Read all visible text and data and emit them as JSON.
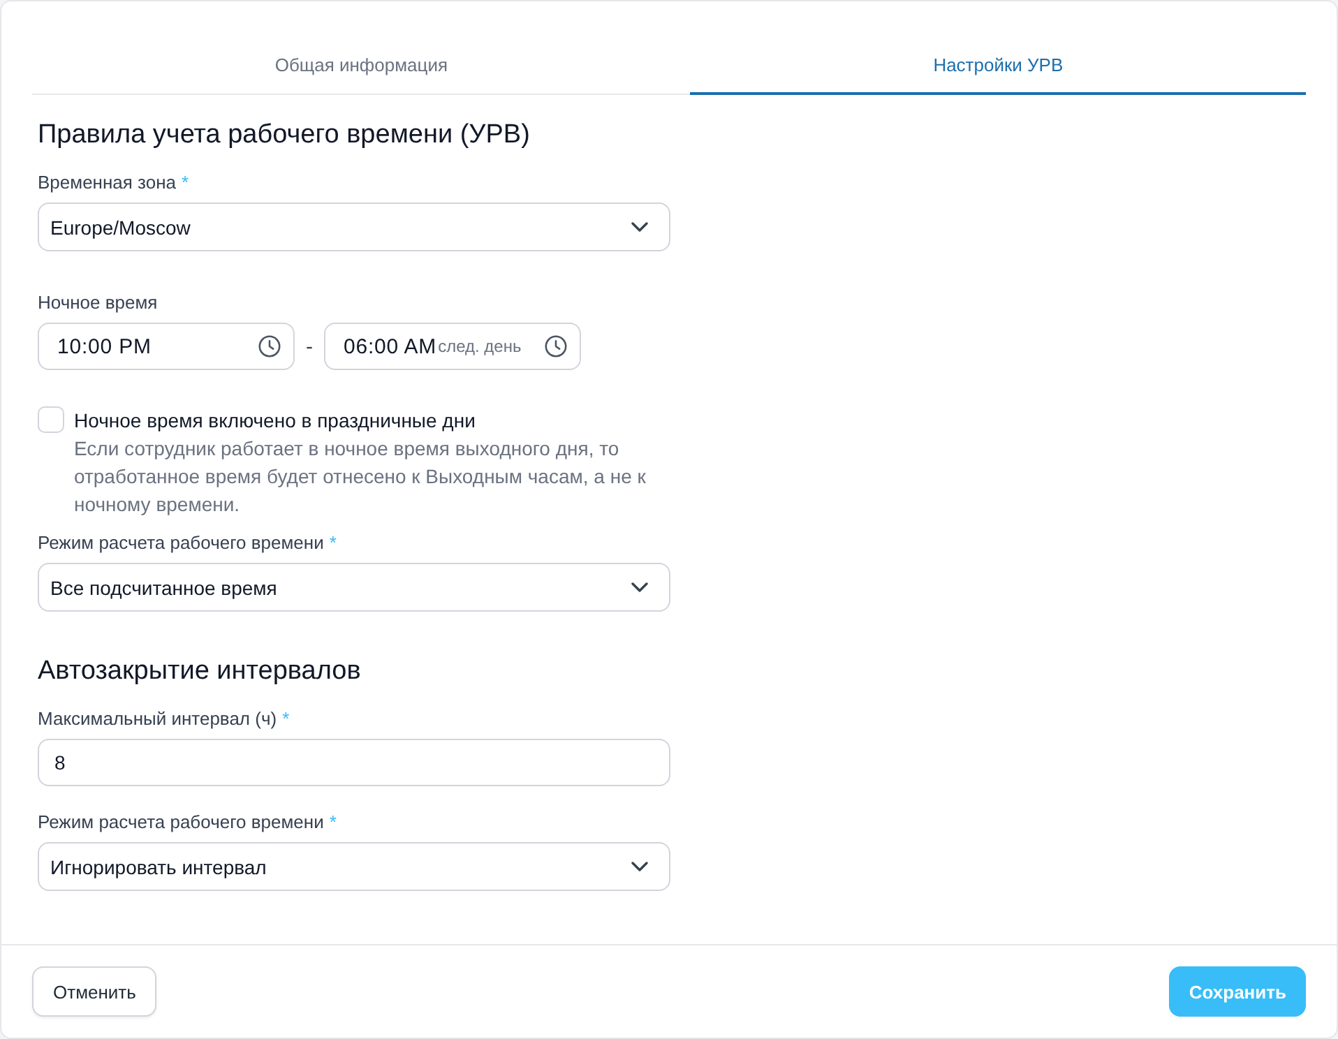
{
  "tabs": [
    {
      "label": "Общая информация",
      "selected": false
    },
    {
      "label": "Настройки УРВ",
      "selected": true
    }
  ],
  "sections": [
    {
      "title": "Правила учета рабочего времени (УРВ)",
      "fields": [
        {
          "kind": "select",
          "label": "Временная зона",
          "required_mark": "*",
          "value": "Europe/Moscow"
        },
        {
          "kind": "time_range",
          "label": "Ночное время",
          "start": {
            "value": "10:00 PM"
          },
          "separator": "-",
          "end": {
            "value": "06:00 AM",
            "hint": "след. день"
          }
        },
        {
          "kind": "checkbox",
          "label": "Ночное время включено в праздничные дни",
          "checked": false,
          "description": "Если сотрудник работает в ночное время выходного дня, то отработанное время будет отнесено к Выходным часам, а не к ночному времени."
        },
        {
          "kind": "select",
          "label": "Режим расчета рабочего времени",
          "required_mark": "*",
          "value": "Все подсчитанное время"
        }
      ]
    },
    {
      "title": "Автозакрытие интервалов",
      "fields": [
        {
          "kind": "input",
          "label": "Максимальный интервал (ч)",
          "required_mark": "*",
          "value": "8"
        },
        {
          "kind": "select",
          "label": "Режим расчета рабочего времени",
          "required_mark": "*",
          "value": "Игнорировать интервал"
        }
      ]
    }
  ],
  "footer": {
    "buttons": [
      {
        "label": "Отменить",
        "kind": "secondary"
      },
      {
        "label": "Сохранить",
        "kind": "primary"
      }
    ]
  }
}
